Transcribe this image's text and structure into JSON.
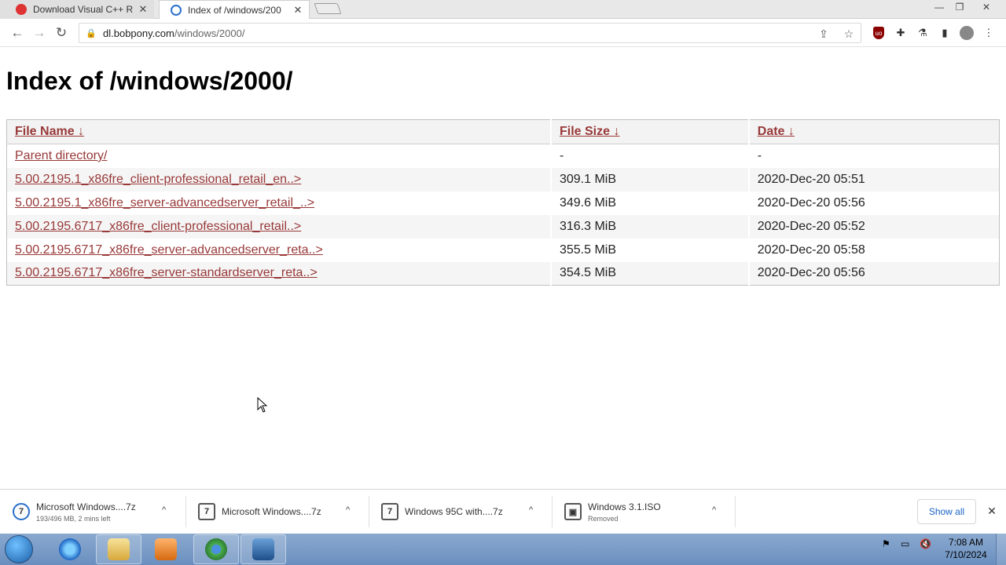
{
  "tabs": [
    {
      "title": "Download Visual C++ R",
      "close": "✕"
    },
    {
      "title": "Index of /windows/200",
      "close": "✕"
    }
  ],
  "window_controls": {
    "minimize": "—",
    "maximize": "❐",
    "close": "✕"
  },
  "toolbar": {
    "back": "←",
    "forward": "→",
    "reload": "↻",
    "url_host": "dl.bobpony.com",
    "url_path": "/windows/2000/",
    "share_icon": "⇪",
    "star_icon": "☆",
    "puzzle_icon": "✚",
    "flask_icon": "⚗",
    "sidepanel_icon": "▮",
    "menu_icon": "⋮"
  },
  "page": {
    "title": "Index of /windows/2000/",
    "columns": [
      {
        "label": "File Name  ↓"
      },
      {
        "label": "File Size  ↓"
      },
      {
        "label": "Date  ↓"
      }
    ],
    "rows": [
      {
        "name": "Parent directory/",
        "size": "-",
        "date": "-"
      },
      {
        "name": "5.00.2195.1_x86fre_client-professional_retail_en..>",
        "size": "309.1 MiB",
        "date": "2020-Dec-20 05:51"
      },
      {
        "name": "5.00.2195.1_x86fre_server-advancedserver_retail_..>",
        "size": "349.6 MiB",
        "date": "2020-Dec-20 05:56"
      },
      {
        "name": "5.00.2195.6717_x86fre_client-professional_retail..>",
        "size": "316.3 MiB",
        "date": "2020-Dec-20 05:52"
      },
      {
        "name": "5.00.2195.6717_x86fre_server-advancedserver_reta..>",
        "size": "355.5 MiB",
        "date": "2020-Dec-20 05:58"
      },
      {
        "name": "5.00.2195.6717_x86fre_server-standardserver_reta..>",
        "size": "354.5 MiB",
        "date": "2020-Dec-20 05:56"
      }
    ]
  },
  "downloads": [
    {
      "name": "Microsoft Windows....7z",
      "status": "193/496 MB, 2 mins left",
      "icon": "7"
    },
    {
      "name": "Microsoft Windows....7z",
      "status": "",
      "icon": "7"
    },
    {
      "name": "Windows 95C with....7z",
      "status": "",
      "icon": "7"
    },
    {
      "name": "Windows 3.1.ISO",
      "status": "Removed",
      "icon": "▣"
    }
  ],
  "download_shelf": {
    "show_all": "Show all",
    "close": "✕",
    "caret": "^"
  },
  "taskbar": {
    "time": "7:08 AM",
    "date": "7/10/2024",
    "tray_flag": "⚑",
    "tray_network": "▭",
    "tray_volume": "🔇"
  },
  "colors": {
    "link": "#983838",
    "header_bg": "#f3f3f3",
    "taskbar": "#7a9cc8",
    "show_all": "#1a63c5"
  }
}
